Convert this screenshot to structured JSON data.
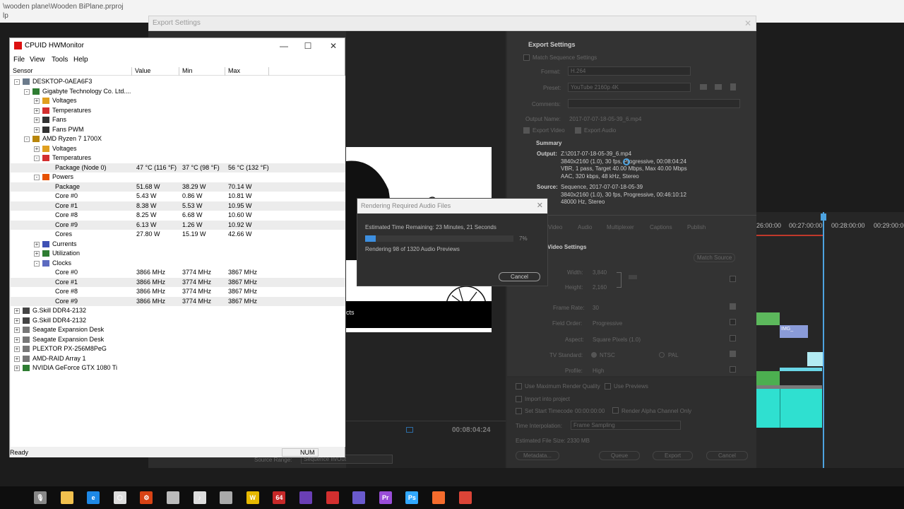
{
  "window_path": "\\wooden plane\\Wooden BiPlane.prproj",
  "window_path_line2": "lp",
  "export_settings": {
    "title": "Export Settings",
    "heading": "Export Settings",
    "match_sequence": "Match Sequence Settings",
    "format_label": "Format:",
    "format_value": "H.264",
    "preset_label": "Preset:",
    "preset_value": "YouTube 2160p 4K",
    "comments_label": "Comments:",
    "output_name_label": "Output Name:",
    "output_name_value": "2017-07-07-18-05-39_6.mp4",
    "export_video": "Export Video",
    "export_audio": "Export Audio",
    "summary_heading": "Summary",
    "output_label": "Output:",
    "output_lines": [
      "Z:\\2017-07-18-05-39_6.mp4",
      "3840x2160 (1.0), 30 fps, Progressive, 00:08:04:24",
      "VBR, 1 pass, Target 40.00 Mbps, Max 40.00 Mbps",
      "AAC, 320 kbps, 48 kHz, Stereo"
    ],
    "source_label": "Source:",
    "source_lines": [
      "Sequence, 2017-07-07-18-05-39",
      "3840x2160 (1.0), 30 fps, Progressive, 00:46:10:12",
      "48000 Hz, Stereo"
    ],
    "tabs": [
      "Video",
      "Audio",
      "Multiplexer",
      "Captions",
      "Publish"
    ],
    "video_settings": "Video Settings",
    "match_source": "Match Source",
    "width_label": "Width:",
    "width_value": "3,840",
    "height_label": "Height:",
    "height_value": "2,160",
    "frame_rate_label": "Frame Rate:",
    "frame_rate_value": "30",
    "field_order_label": "Field Order:",
    "field_order_value": "Progressive",
    "aspect_label": "Aspect:",
    "aspect_value": "Square Pixels (1.0)",
    "tv_standard_label": "TV Standard:",
    "ntsc": "NTSC",
    "pal": "PAL",
    "profile_label": "Profile:",
    "profile_value": "High",
    "max_render_quality": "Use Maximum Render Quality",
    "use_previews": "Use Previews",
    "import_into_project": "Import into project",
    "set_start_timecode": "Set Start Timecode",
    "start_timecode": "00:00:00:00",
    "render_alpha": "Render Alpha Channel Only",
    "time_interpolation_label": "Time Interpolation:",
    "time_interpolation_value": "Frame Sampling",
    "est_file_size": "Estimated File Size: 2330 MB",
    "metadata_btn": "Metadata...",
    "queue_btn": "Queue",
    "export_btn": "Export",
    "cancel_btn": "Cancel",
    "preview_timecode": "00:08:04:24",
    "preview_label": "cts",
    "source_range": "Source Range:",
    "source_range_value": "Sequence In/Out"
  },
  "timeline": {
    "times": [
      "26:00:00",
      "00:27:00:00",
      "00:28:00:00",
      "00:29:00:00"
    ],
    "clip_label": "IMG_"
  },
  "hwmonitor": {
    "title": "CPUID HWMonitor",
    "menu": [
      "File",
      "View",
      "Tools",
      "Help"
    ],
    "columns": [
      "Sensor",
      "Value",
      "Min",
      "Max"
    ],
    "rows": [
      {
        "label": "DESKTOP-0AEA6F3",
        "level": 0,
        "exp": "-",
        "icon": "computer-icon",
        "value": "",
        "min": "",
        "max": ""
      },
      {
        "label": "Gigabyte Technology Co. Ltd....",
        "level": 1,
        "exp": "-",
        "icon": "motherboard-icon",
        "value": "",
        "min": "",
        "max": ""
      },
      {
        "label": "Voltages",
        "level": 2,
        "exp": "+",
        "icon": "voltage-icon",
        "value": "",
        "min": "",
        "max": ""
      },
      {
        "label": "Temperatures",
        "level": 2,
        "exp": "+",
        "icon": "thermometer-icon",
        "value": "",
        "min": "",
        "max": ""
      },
      {
        "label": "Fans",
        "level": 2,
        "exp": "+",
        "icon": "fan-icon",
        "value": "",
        "min": "",
        "max": ""
      },
      {
        "label": "Fans PWM",
        "level": 2,
        "exp": "+",
        "icon": "fan-icon",
        "value": "",
        "min": "",
        "max": ""
      },
      {
        "label": "AMD Ryzen 7 1700X",
        "level": 1,
        "exp": "-",
        "icon": "cpu-icon",
        "value": "",
        "min": "",
        "max": ""
      },
      {
        "label": "Voltages",
        "level": 2,
        "exp": "+",
        "icon": "voltage-icon",
        "value": "",
        "min": "",
        "max": ""
      },
      {
        "label": "Temperatures",
        "level": 2,
        "exp": "-",
        "icon": "thermometer-icon",
        "value": "",
        "min": "",
        "max": ""
      },
      {
        "label": "Package (Node 0)",
        "level": 3,
        "exp": "",
        "icon": "",
        "value": "47 °C  (116 °F)",
        "min": "37 °C  (98 °F)",
        "max": "56 °C  (132 °F)"
      },
      {
        "label": "Powers",
        "level": 2,
        "exp": "-",
        "icon": "power-icon",
        "value": "",
        "min": "",
        "max": ""
      },
      {
        "label": "Package",
        "level": 3,
        "exp": "",
        "icon": "",
        "value": "51.68 W",
        "min": "38.29 W",
        "max": "70.14 W"
      },
      {
        "label": "Core #0",
        "level": 3,
        "exp": "",
        "icon": "",
        "value": "5.43 W",
        "min": "0.86 W",
        "max": "10.81 W"
      },
      {
        "label": "Core #1",
        "level": 3,
        "exp": "",
        "icon": "",
        "value": "8.38 W",
        "min": "5.53 W",
        "max": "10.95 W"
      },
      {
        "label": "Core #8",
        "level": 3,
        "exp": "",
        "icon": "",
        "value": "8.25 W",
        "min": "6.68 W",
        "max": "10.60 W"
      },
      {
        "label": "Core #9",
        "level": 3,
        "exp": "",
        "icon": "",
        "value": "6.13 W",
        "min": "1.26 W",
        "max": "10.92 W"
      },
      {
        "label": "Cores",
        "level": 3,
        "exp": "",
        "icon": "",
        "value": "27.80 W",
        "min": "15.19 W",
        "max": "42.66 W"
      },
      {
        "label": "Currents",
        "level": 2,
        "exp": "+",
        "icon": "current-icon",
        "value": "",
        "min": "",
        "max": ""
      },
      {
        "label": "Utilization",
        "level": 2,
        "exp": "+",
        "icon": "utilization-icon",
        "value": "",
        "min": "",
        "max": ""
      },
      {
        "label": "Clocks",
        "level": 2,
        "exp": "-",
        "icon": "clock-icon",
        "value": "",
        "min": "",
        "max": ""
      },
      {
        "label": "Core #0",
        "level": 3,
        "exp": "",
        "icon": "",
        "value": "3866 MHz",
        "min": "3774 MHz",
        "max": "3867 MHz"
      },
      {
        "label": "Core #1",
        "level": 3,
        "exp": "",
        "icon": "",
        "value": "3866 MHz",
        "min": "3774 MHz",
        "max": "3867 MHz"
      },
      {
        "label": "Core #8",
        "level": 3,
        "exp": "",
        "icon": "",
        "value": "3866 MHz",
        "min": "3774 MHz",
        "max": "3867 MHz"
      },
      {
        "label": "Core #9",
        "level": 3,
        "exp": "",
        "icon": "",
        "value": "3866 MHz",
        "min": "3774 MHz",
        "max": "3867 MHz"
      },
      {
        "label": "G.Skill DDR4-2132",
        "level": 0,
        "exp": "+",
        "icon": "memory-icon",
        "value": "",
        "min": "",
        "max": ""
      },
      {
        "label": "G.Skill DDR4-2132",
        "level": 0,
        "exp": "+",
        "icon": "memory-icon",
        "value": "",
        "min": "",
        "max": ""
      },
      {
        "label": "Seagate Expansion Desk",
        "level": 0,
        "exp": "+",
        "icon": "disk-icon",
        "value": "",
        "min": "",
        "max": ""
      },
      {
        "label": "Seagate Expansion Desk",
        "level": 0,
        "exp": "+",
        "icon": "disk-icon",
        "value": "",
        "min": "",
        "max": ""
      },
      {
        "label": "PLEXTOR PX-256M8PeG",
        "level": 0,
        "exp": "+",
        "icon": "disk-icon",
        "value": "",
        "min": "",
        "max": ""
      },
      {
        "label": "AMD-RAID Array 1",
        "level": 0,
        "exp": "+",
        "icon": "disk-icon",
        "value": "",
        "min": "",
        "max": ""
      },
      {
        "label": "NVIDIA GeForce GTX 1080 Ti",
        "level": 0,
        "exp": "+",
        "icon": "gpu-icon",
        "value": "",
        "min": "",
        "max": ""
      }
    ],
    "status": "Ready",
    "num": "NUM"
  },
  "render_dialog": {
    "title": "Rendering Required Audio Files",
    "estimated": "Estimated Time Remaining: 23 Minutes, 21 Seconds",
    "percent_text": "7%",
    "progress": 0.07,
    "status": "Rendering 98 of 1320 Audio Previews",
    "cancel": "Cancel"
  },
  "taskbar_icons": [
    {
      "name": "microphone-icon",
      "color": "#888888",
      "text": "🎙"
    },
    {
      "name": "file-explorer-icon",
      "color": "#f2c14e",
      "text": ""
    },
    {
      "name": "edge-icon",
      "color": "#1e88e5",
      "text": "e"
    },
    {
      "name": "3d-app-icon",
      "color": "#dddddd",
      "text": "⬡"
    },
    {
      "name": "gear-app-icon",
      "color": "#d84315",
      "text": "⚙"
    },
    {
      "name": "racing-app-icon",
      "color": "#bbbbbb",
      "text": ""
    },
    {
      "name": "itunes-icon",
      "color": "#dddddd",
      "text": "♪"
    },
    {
      "name": "tool-app-icon",
      "color": "#aaaaaa",
      "text": ""
    },
    {
      "name": "winamp-icon",
      "color": "#e6b800",
      "text": "W"
    },
    {
      "name": "aida64-icon",
      "color": "#c62828",
      "text": "64"
    },
    {
      "name": "cpu-app-icon",
      "color": "#6a3fb5",
      "text": ""
    },
    {
      "name": "hwmonitor-icon",
      "color": "#d32f2f",
      "text": ""
    },
    {
      "name": "media-encoder-icon",
      "color": "#6a5acd",
      "text": ""
    },
    {
      "name": "premiere-pro-icon",
      "color": "#9a4dd8",
      "text": "Pr"
    },
    {
      "name": "photoshop-icon",
      "color": "#31a8ff",
      "text": "Ps"
    },
    {
      "name": "origin-icon",
      "color": "#f56c2d",
      "text": ""
    },
    {
      "name": "chrome-icon",
      "color": "#db4437",
      "text": ""
    }
  ]
}
